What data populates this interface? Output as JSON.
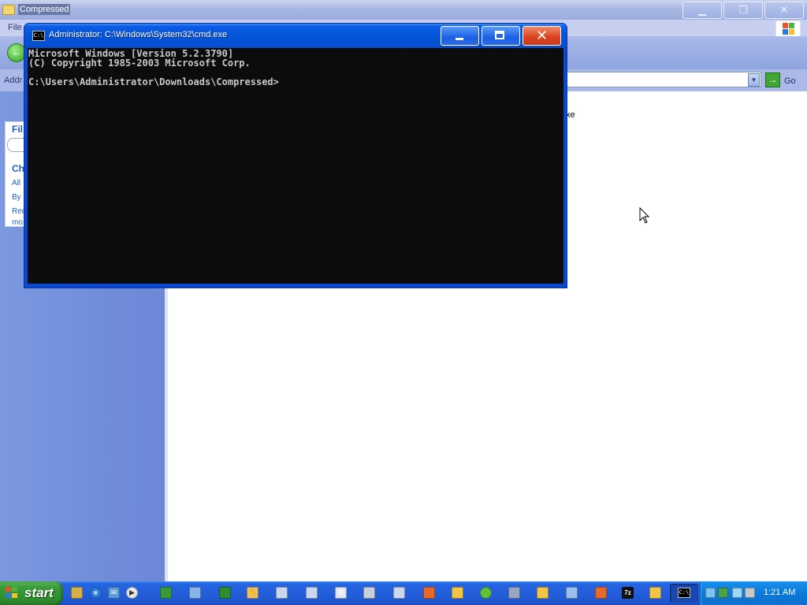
{
  "explorer": {
    "title": "Compressed",
    "menu_file": "File",
    "address_label": "Addr",
    "go_label": "Go",
    "panel_heading": "Fil",
    "panel_subheading": "Ch",
    "panel_links": [
      "All",
      "By",
      "Rec",
      "mo"
    ],
    "file_fragment": "xe",
    "controls": {
      "minimize": "▁",
      "restore": "❐",
      "close": "✕"
    }
  },
  "cmd": {
    "title": "Administrator: C:\\Windows\\System32\\cmd.exe",
    "icon_text": "C:\\",
    "lines": [
      "Microsoft Windows [Version 5.2.3790]",
      "(C) Copyright 1985-2003 Microsoft Corp.",
      "",
      "C:\\Users\\Administrator\\Downloads\\Compressed>"
    ],
    "close_glyph": "✕"
  },
  "taskbar": {
    "start_label": "start",
    "clock": "1:21 AM",
    "quicklaunch_icons": [
      "show-desktop-icon",
      "internet-explorer-icon",
      "outlook-express-icon",
      "media-player-icon",
      "network-globe-icon",
      "computer-icon",
      "recycle-icon",
      "hand-tool-icon",
      "document-icon",
      "document-icon-2",
      "gear-icon",
      "monitor-icon",
      "document-icon-3",
      "traffic-cone-icon",
      "folder-icon",
      "green-circle-icon",
      "tools-icon",
      "folder-icon-2",
      "server-icon",
      "traffic-cone-icon-2",
      "7zip-icon",
      "folder-icon-3"
    ],
    "quicklaunch_glyphs": [
      "",
      "e",
      "✉",
      "▶",
      "",
      "",
      "",
      "✋",
      "",
      "",
      "⚙",
      "",
      "",
      "",
      "",
      "",
      "",
      "",
      "",
      "",
      "7z",
      ""
    ],
    "quicklaunch_colors": [
      "#d6b04a",
      "#2a7be0",
      "#5a9bd8",
      "#e8e8e8",
      "#3a9a3a",
      "#8ab4e8",
      "#2e8b2e",
      "#e8c070",
      "#c9d8ee",
      "#c9d8ee",
      "#dfe6f4",
      "#c9d0dc",
      "#c9d8ee",
      "#e86a2a",
      "#f0c54a",
      "#5fc03a",
      "#9aa6c0",
      "#f0c54a",
      "#9cc0ee",
      "#e86a2a",
      "#111111",
      "#f0c54a"
    ],
    "tray_icons": [
      "network-icon",
      "tray-app-icon",
      "network-computers-icon",
      "volume-icon"
    ],
    "tray_colors": [
      "#7ec3f0",
      "#4da24d",
      "#9ed6f5",
      "#c8c8c8"
    ]
  },
  "colors": {
    "cmd_frame": "#0a4ad1",
    "cmd_background": "#0c0c0c",
    "cmd_text": "#c8c8c8",
    "taskbar": "#245edb",
    "start_button": "#3a9c39",
    "explorer_leftpane": "#7b98e0"
  }
}
